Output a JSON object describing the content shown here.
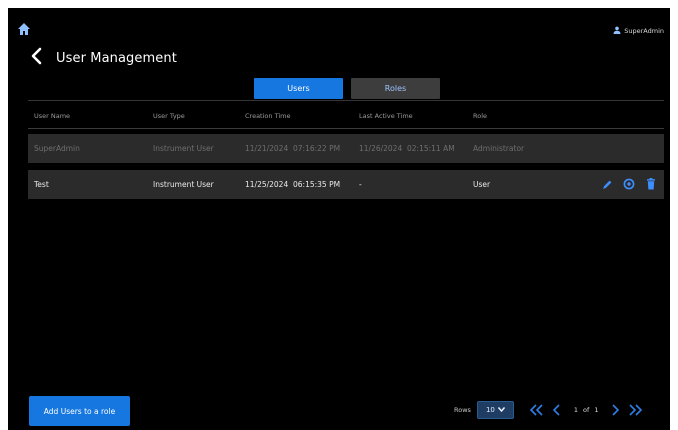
{
  "header": {
    "user_name": "SuperAdmin",
    "user_icon": "person-icon",
    "home_icon": "home-icon",
    "back_icon": "chevron-left-icon"
  },
  "page": {
    "title": "User Management"
  },
  "tabs": [
    {
      "label": "Users",
      "active": true
    },
    {
      "label": "Roles",
      "active": false
    }
  ],
  "table": {
    "columns": [
      "User Name",
      "User Type",
      "Creation Time",
      "Last Active Time",
      "Role"
    ],
    "rows": [
      {
        "user_name": "SuperAdmin",
        "user_type": "Instrument User",
        "creation_time": "11/21/2024  07:16:22 PM",
        "last_active_time": "11/26/2024  02:15:11 AM",
        "role": "Administrator",
        "disabled": true
      },
      {
        "user_name": "Test",
        "user_type": "Instrument User",
        "creation_time": "11/25/2024  06:15:35 PM",
        "last_active_time": "-",
        "role": "User",
        "disabled": false,
        "actions": [
          "edit-icon",
          "reset-password-icon",
          "delete-icon"
        ]
      }
    ]
  },
  "footer": {
    "add_button_label": "Add Users to a role",
    "rows_label": "Rows",
    "rows_per_page": "10",
    "current_page": "1",
    "of_label": "of",
    "total_pages": "1"
  },
  "colors": {
    "background": "#000000",
    "accent": "#1677e0",
    "row_background": "#2b2b2b",
    "tab_inactive": "#3d3d3d"
  }
}
